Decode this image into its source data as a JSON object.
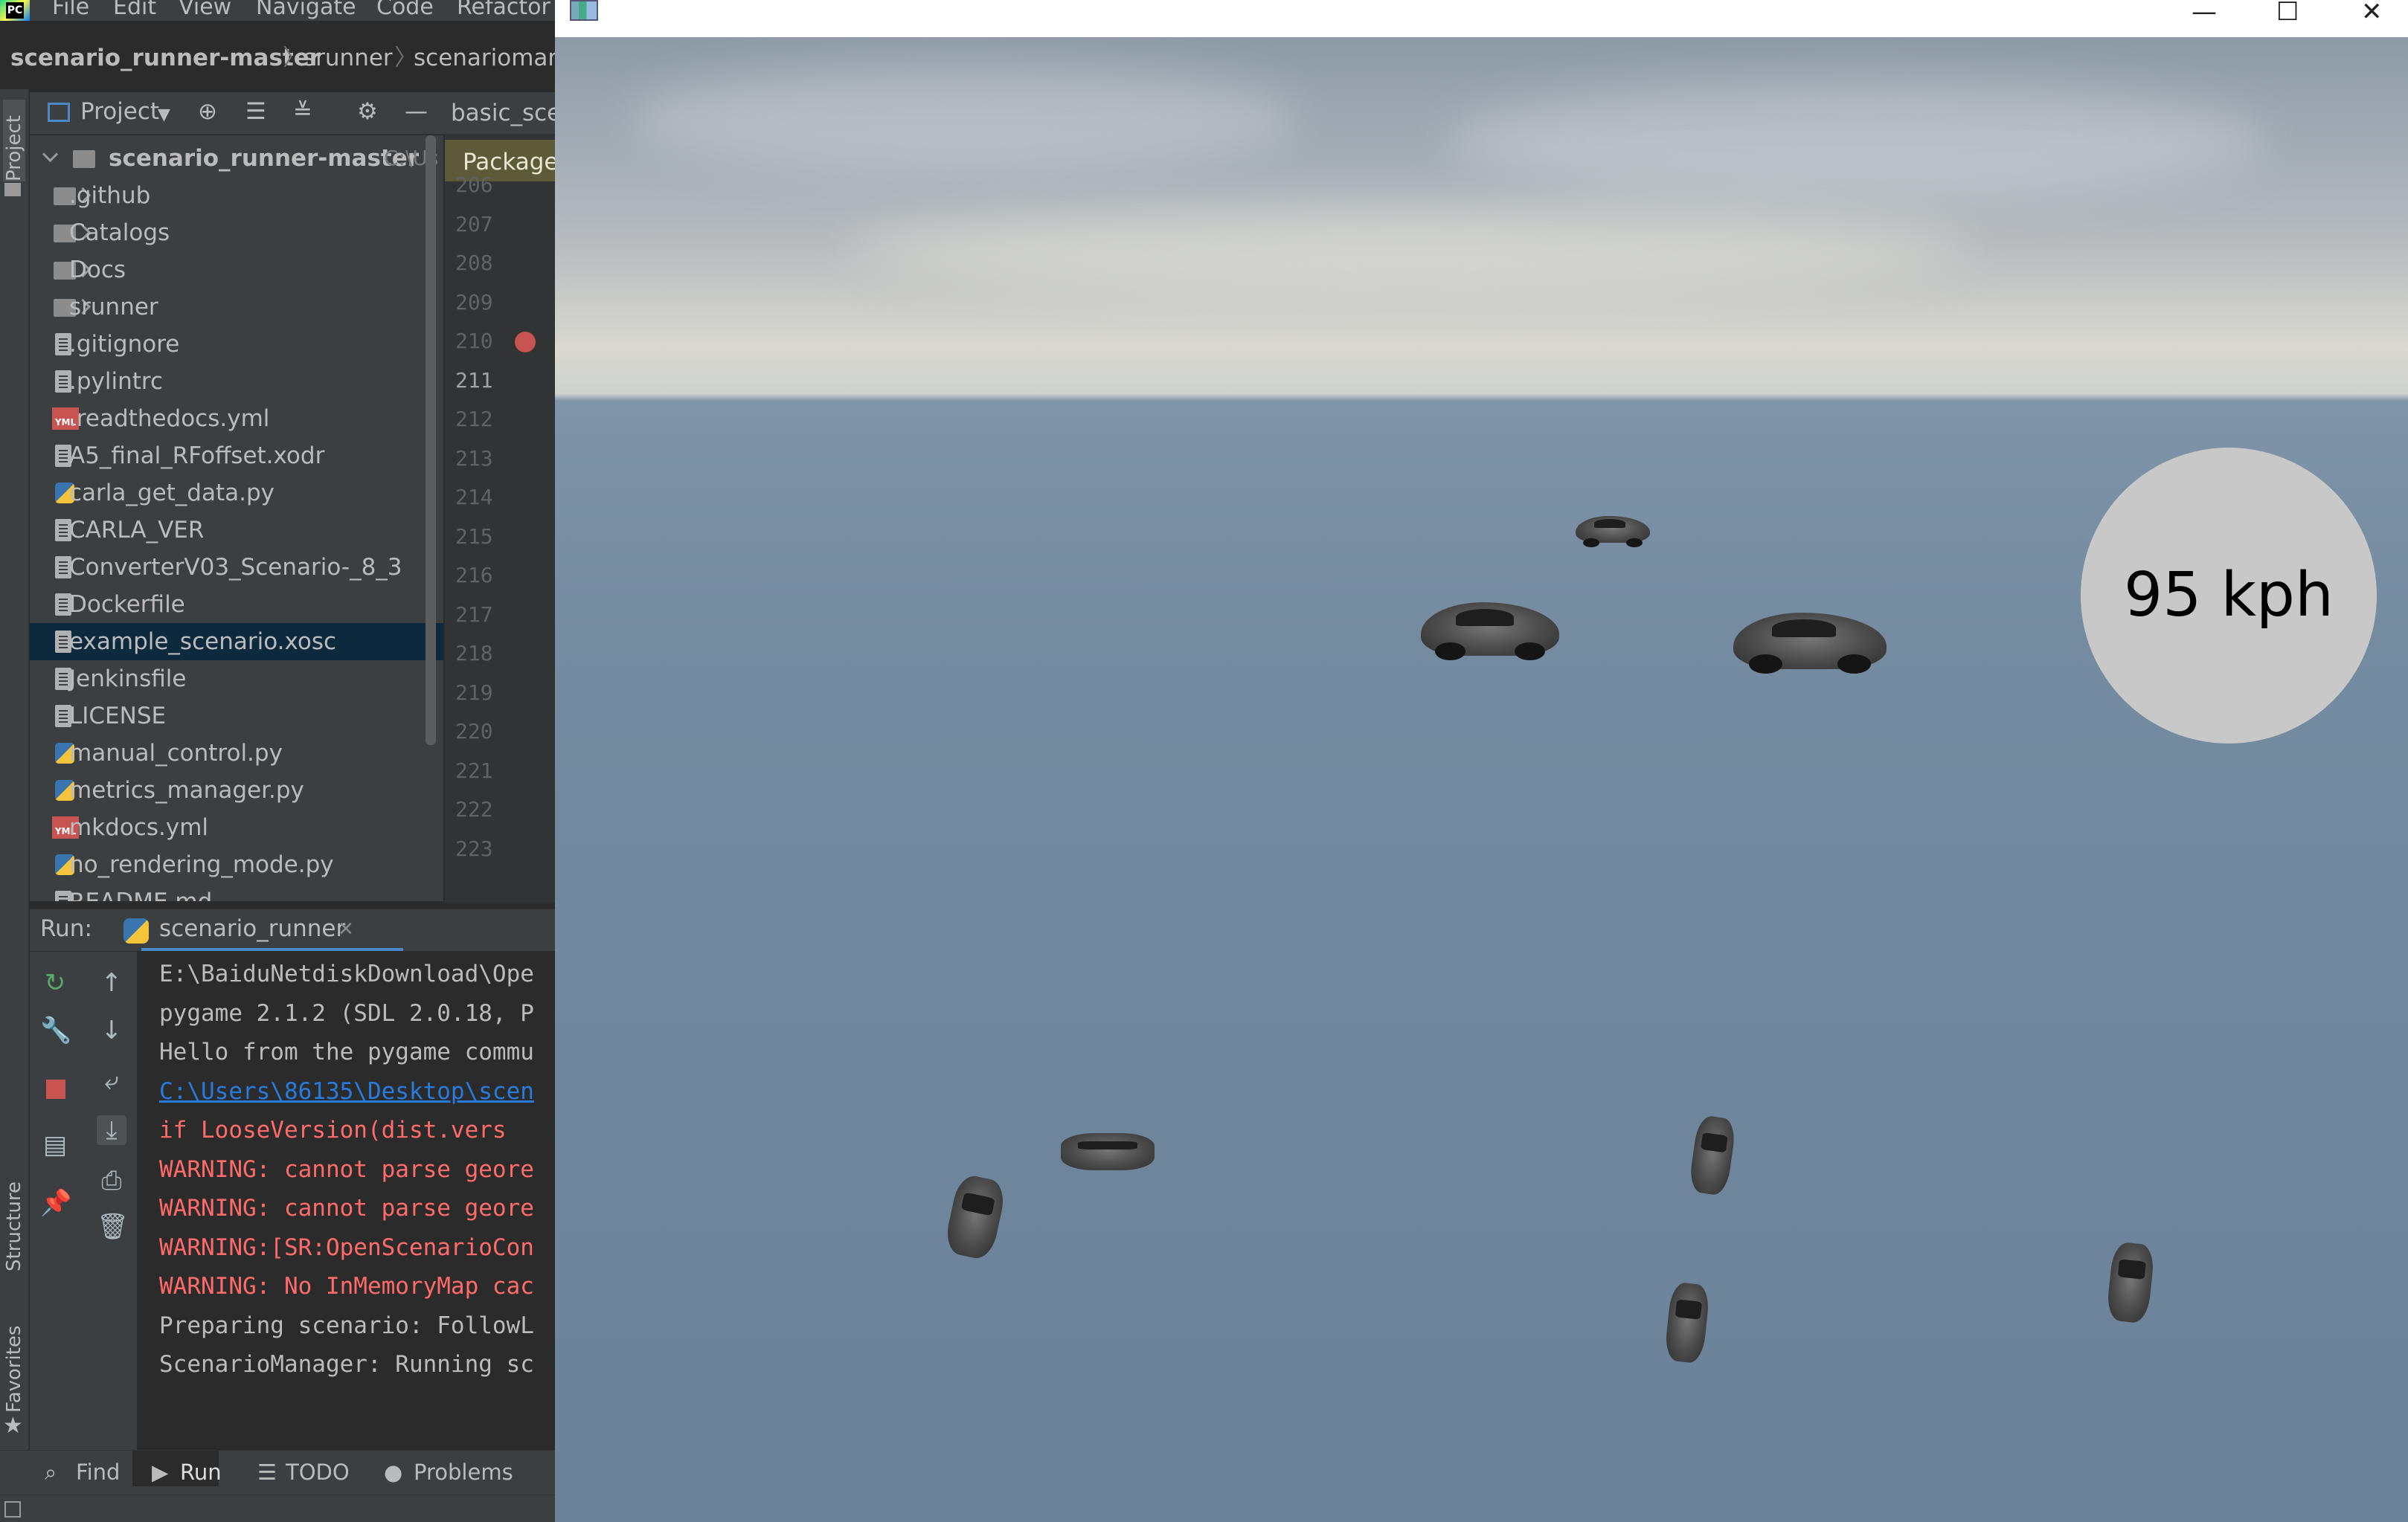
{
  "ide": {
    "menu": [
      "File",
      "Edit",
      "View",
      "Navigate",
      "Code",
      "Refactor"
    ],
    "breadcrumbs": [
      "scenario_runner-master",
      "srunner",
      "scenariomana"
    ],
    "left_strip": {
      "project": "Project",
      "structure": "Structure",
      "favorites": "Favorites"
    },
    "project_toolbar": {
      "label": "Project",
      "tab": "basic_scer",
      "package_hint": "Package"
    },
    "tree": {
      "root": {
        "name": "scenario_runner-master",
        "path": "C:\\Us"
      },
      "items": [
        {
          "name": ".github",
          "icon": "folder-icon",
          "expandable": true
        },
        {
          "name": "Catalogs",
          "icon": "folder-icon",
          "expandable": true
        },
        {
          "name": "Docs",
          "icon": "folder-icon",
          "expandable": true
        },
        {
          "name": "srunner",
          "icon": "package-folder-icon",
          "expandable": true
        },
        {
          "name": ".gitignore",
          "icon": "file-icon"
        },
        {
          "name": ".pylintrc",
          "icon": "file-icon"
        },
        {
          "name": ".readthedocs.yml",
          "icon": "yml-icon"
        },
        {
          "name": "A5_final_RFoffset.xodr",
          "icon": "file-icon"
        },
        {
          "name": "carla_get_data.py",
          "icon": "python-icon"
        },
        {
          "name": "CARLA_VER",
          "icon": "file-icon"
        },
        {
          "name": "ConverterV03_Scenario-_8_3",
          "icon": "file-icon"
        },
        {
          "name": "Dockerfile",
          "icon": "file-icon"
        },
        {
          "name": "example_scenario.xosc",
          "icon": "file-icon",
          "selected": true
        },
        {
          "name": "Jenkinsfile",
          "icon": "file-icon"
        },
        {
          "name": "LICENSE",
          "icon": "file-icon"
        },
        {
          "name": "manual_control.py",
          "icon": "python-icon"
        },
        {
          "name": "metrics_manager.py",
          "icon": "python-icon"
        },
        {
          "name": "mkdocs.yml",
          "icon": "yml-icon"
        },
        {
          "name": "no_rendering_mode.py",
          "icon": "python-icon"
        },
        {
          "name": "README.md",
          "icon": "file-icon"
        }
      ]
    },
    "line_numbers": [
      "206",
      "207",
      "208",
      "209",
      "210",
      "211",
      "212",
      "213",
      "214",
      "215",
      "216",
      "217",
      "218",
      "219",
      "220",
      "221",
      "222",
      "223"
    ],
    "current_line": "211",
    "breakpoint_line": "210",
    "run": {
      "label": "Run:",
      "config": "scenario_runner",
      "console": [
        {
          "text": "E:\\BaiduNetdiskDownload\\Ope",
          "kind": "normal"
        },
        {
          "text": "pygame 2.1.2 (SDL 2.0.18, P",
          "kind": "normal"
        },
        {
          "text": "Hello from the pygame commu",
          "kind": "normal"
        },
        {
          "text": "C:\\Users\\86135\\Desktop\\scen",
          "kind": "link"
        },
        {
          "text": "  if LooseVersion(dist.vers",
          "kind": "error"
        },
        {
          "text": "WARNING: cannot parse geore",
          "kind": "error"
        },
        {
          "text": "WARNING: cannot parse geore",
          "kind": "error"
        },
        {
          "text": "WARNING:[SR:OpenScenarioCon",
          "kind": "error"
        },
        {
          "text": "WARNING: No InMemoryMap cac",
          "kind": "error"
        },
        {
          "text": "Preparing scenario: FollowL",
          "kind": "normal"
        },
        {
          "text": "ScenarioManager: Running sc",
          "kind": "normal"
        }
      ]
    },
    "bottom_tabs": [
      {
        "label": "Find",
        "icon": "search-icon"
      },
      {
        "label": "Run",
        "icon": "play-icon"
      },
      {
        "label": "TODO",
        "icon": "list-icon"
      },
      {
        "label": "Problems",
        "icon": "info-icon"
      }
    ]
  },
  "game": {
    "window_controls": {
      "minimize": "—",
      "maximize": "☐",
      "close": "✕"
    },
    "speed": "95 kph"
  },
  "colors": {
    "ide_bg": "#2b2b2b",
    "panel_bg": "#3c3f41",
    "selection": "#0d293e",
    "console_error": "#ff6b68",
    "console_link": "#287bde",
    "breakpoint": "#c75450",
    "speedometer": "#c8c8c8"
  }
}
